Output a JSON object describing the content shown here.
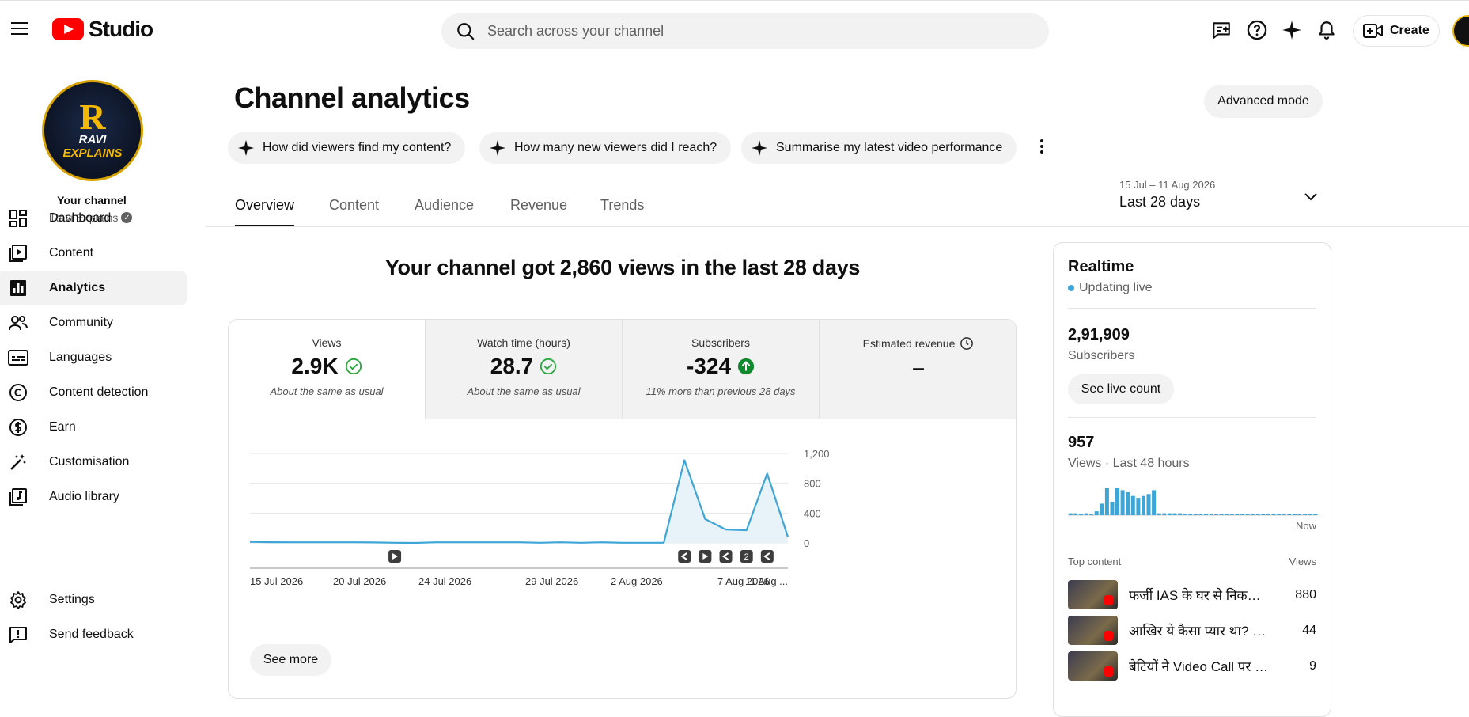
{
  "app": {
    "brand": "Studio",
    "brand_color": "#ff0000"
  },
  "search": {
    "placeholder": "Search across your channel"
  },
  "header": {
    "icons": [
      "create-post-icon",
      "help-icon",
      "sparkle-icon",
      "bell-icon"
    ],
    "create_label": "Create"
  },
  "sidebar": {
    "your_channel": "Your channel",
    "channel_name": "Ravi Explains",
    "avatar_text_1": "R",
    "avatar_text_2": "RAVI",
    "avatar_text_3": "EXPLAINS",
    "items": [
      {
        "label": "Dashboard",
        "icon": "dashboard-icon"
      },
      {
        "label": "Content",
        "icon": "content-icon"
      },
      {
        "label": "Analytics",
        "icon": "analytics-icon",
        "active": true
      },
      {
        "label": "Community",
        "icon": "community-icon"
      },
      {
        "label": "Languages",
        "icon": "languages-icon"
      },
      {
        "label": "Content detection",
        "icon": "copyright-icon"
      },
      {
        "label": "Earn",
        "icon": "dollar-icon"
      },
      {
        "label": "Customisation",
        "icon": "magic-wand-icon"
      },
      {
        "label": "Audio library",
        "icon": "audio-library-icon"
      }
    ],
    "bottom_items": [
      {
        "label": "Settings",
        "icon": "gear-icon"
      },
      {
        "label": "Send feedback",
        "icon": "feedback-icon"
      }
    ]
  },
  "main": {
    "title": "Channel analytics",
    "advanced_mode": "Advanced mode",
    "chips": [
      "How did viewers find my content?",
      "How many new viewers did I reach?",
      "Summarise my latest video performance"
    ],
    "tabs": [
      "Overview",
      "Content",
      "Audience",
      "Revenue",
      "Trends"
    ],
    "active_tab": "Overview",
    "date_range": "15 Jul – 11 Aug 2026",
    "date_label": "Last 28 days",
    "headline": "Your channel got 2,860 views in the last 28 days",
    "metrics": [
      {
        "label": "Views",
        "value": "2.9K",
        "note": "About the same as usual",
        "status": "check"
      },
      {
        "label": "Watch time (hours)",
        "value": "28.7",
        "note": "About the same as usual",
        "status": "check"
      },
      {
        "label": "Subscribers",
        "value": "-324",
        "note": "11% more than previous 28 days",
        "status": "up"
      },
      {
        "label": "Estimated revenue",
        "value": "–",
        "note": "",
        "status": "clock"
      }
    ],
    "see_more": "See more",
    "colors": {
      "line": "#3ea6d7",
      "fill": "#e8f3f9",
      "check": "#2ba640",
      "up": "#0f8a2f"
    }
  },
  "chart_data": {
    "type": "area",
    "x_tick_labels": [
      "15 Jul 2026",
      "20 Jul 2026",
      "24 Jul 2026",
      "29 Jul 2026",
      "2 Aug 2026",
      "7 Aug 2026",
      "11 Aug ..."
    ],
    "y_tick_labels": [
      "1,200",
      "800",
      "400",
      "0"
    ],
    "ylim": [
      0,
      1200
    ],
    "values": [
      15,
      10,
      8,
      8,
      8,
      8,
      6,
      2,
      0,
      8,
      8,
      8,
      8,
      8,
      2,
      8,
      2,
      8,
      2,
      2,
      2,
      1110,
      320,
      180,
      170,
      930,
      80
    ],
    "upload_markers": [
      {
        "index": 7,
        "kind": "video"
      },
      {
        "index": 21,
        "kind": "short"
      },
      {
        "index": 22,
        "kind": "video"
      },
      {
        "index": 23,
        "kind": "short"
      },
      {
        "index": 24,
        "kind": "count",
        "label": "2"
      },
      {
        "index": 25,
        "kind": "short"
      }
    ]
  },
  "realtime": {
    "title": "Realtime",
    "status": "Updating live",
    "subscribers_value": "2,91,909",
    "subscribers_label": "Subscribers",
    "see_live_count": "See live count",
    "views_value": "957",
    "views_label": "Views · Last 48 hours",
    "now_label": "Now",
    "bars": [
      1,
      1,
      0,
      1,
      0,
      2,
      6,
      14,
      7,
      14,
      13,
      12,
      10,
      9,
      10,
      11,
      13,
      1,
      1,
      1,
      1,
      1,
      0.8,
      0.7,
      0.5,
      0.6,
      0.4,
      0.3,
      0.3,
      0.2,
      0.2,
      0.2,
      0.1,
      0.1,
      0.1,
      0.1,
      0.1,
      0.1,
      0.1,
      0.1,
      0.1,
      0.1,
      0.2,
      0.1,
      0.1,
      0.1,
      0.1,
      0.1
    ],
    "top_content_label": "Top content",
    "views_col_label": "Views",
    "top_content": [
      {
        "title": "फर्जी IAS के घर से निकला ...",
        "views": "880"
      },
      {
        "title": "आखिर ये कैसा प्यार था? क्या “...",
        "views": "44"
      },
      {
        "title": "बेटियों ने Video Call पर दी पि...",
        "views": "9"
      }
    ]
  }
}
